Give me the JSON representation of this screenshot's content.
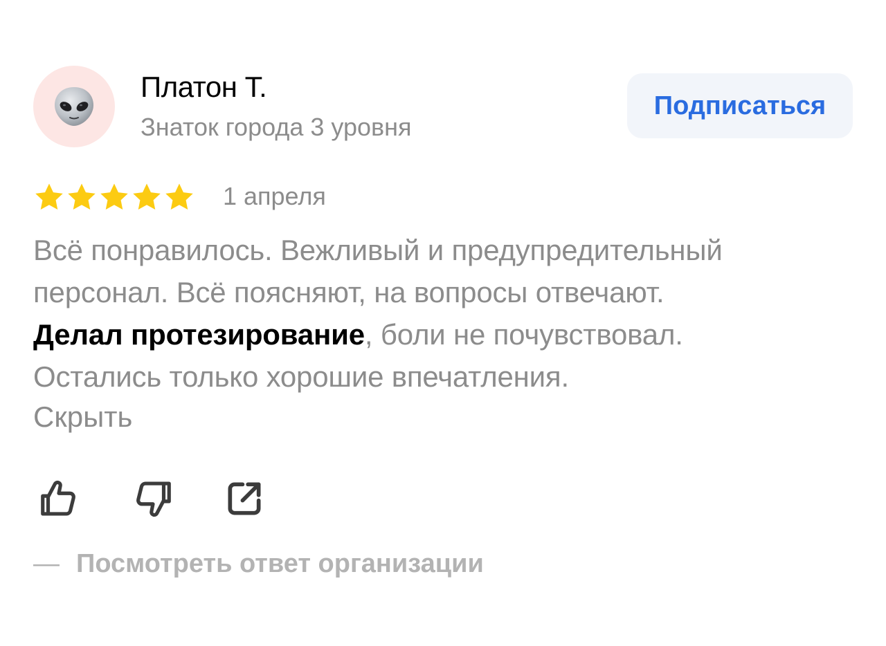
{
  "author": {
    "name": "Платон Т.",
    "level": "Знаток города 3 уровня",
    "avatar_icon": "alien-emoji-icon",
    "avatar_bg": "#fde6e4"
  },
  "subscribe": {
    "label": "Подписаться",
    "color": "#2a6ce0"
  },
  "review": {
    "rating": 5,
    "rating_max": 5,
    "star_color": "#fccb12",
    "date": "1 апреля",
    "lines": [
      "Всё понравилось. Вежливый и предупредительный",
      "персонал. Всё поясняют, на вопросы отвечают."
    ],
    "highlight": "Делал протезирование",
    "line3_rest": ", боли не почувствовал.",
    "line4": "Остались только хорошие впечатления.",
    "hide_label": "Скрыть"
  },
  "actions": [
    {
      "name": "like",
      "icon": "thumbs-up-icon"
    },
    {
      "name": "dislike",
      "icon": "thumbs-down-icon"
    },
    {
      "name": "share",
      "icon": "share-icon"
    }
  ],
  "org_reply": {
    "dash": "—",
    "label": "Посмотреть ответ организации"
  }
}
